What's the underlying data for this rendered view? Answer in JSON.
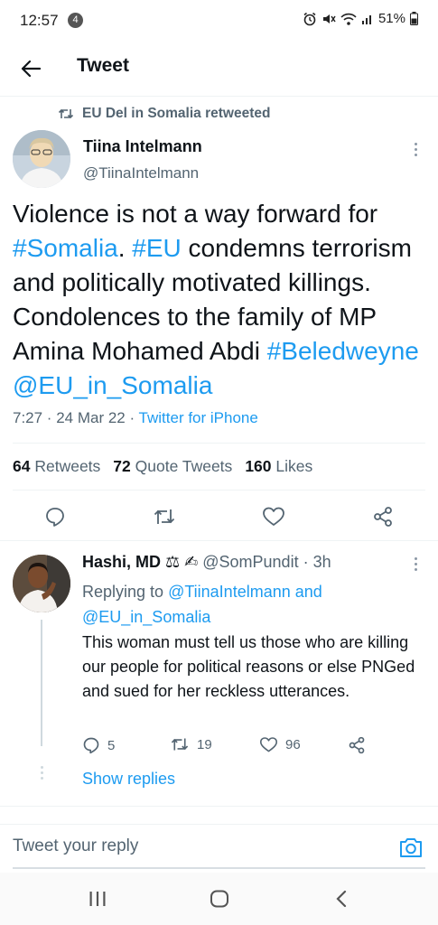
{
  "status_bar": {
    "time": "12:57",
    "notification_count": "4",
    "battery": "51%"
  },
  "header": {
    "title": "Tweet"
  },
  "retweet_context": "EU Del in Somalia retweeted",
  "main_tweet": {
    "author_name": "Tiina Intelmann",
    "author_handle": "@TiinaIntelmann",
    "text_parts": {
      "p1": "Violence is not a way forward for ",
      "tag1": "#Somalia",
      "p2": ". ",
      "tag2": "#EU",
      "p3": " condemns terrorism and politically motivated killings. Condolences to the family of MP Amina Mohamed Abdi ",
      "tag3": "#Beledweyne",
      "p4": " ",
      "tag4": "@EU_in_Somalia"
    },
    "timestamp": "7:27 · 24 Mar 22 · ",
    "source": "Twitter for iPhone",
    "stats": {
      "retweets_count": "64",
      "retweets_label": "Retweets",
      "quotes_count": "72",
      "quotes_label": "Quote Tweets",
      "likes_count": "160",
      "likes_label": "Likes"
    }
  },
  "reply": {
    "author_name": "Hashi, MD ⚖ ✍",
    "author_handle": "@SomPundit",
    "time": " · 3h",
    "replying_prefix": "Replying to ",
    "mention1": "@TiinaIntelmann",
    "and_text": " and ",
    "mention2": "@EU_in_Somalia",
    "text": "This woman must tell us those who are killing our people for political reasons or else PNGed and sued for her reckless utterances.",
    "reply_count": "5",
    "retweet_count": "19",
    "like_count": "96",
    "show_replies": "Show replies"
  },
  "composer": {
    "placeholder": "Tweet your reply"
  },
  "icons": {
    "back": "arrow-left-icon",
    "reply": "comment-icon",
    "retweet": "retweet-icon",
    "like": "heart-icon",
    "share": "share-icon",
    "camera": "camera-icon"
  },
  "colors": {
    "accent": "#1d9bf0",
    "secondary_text": "#536471",
    "primary_text": "#0f1419"
  }
}
